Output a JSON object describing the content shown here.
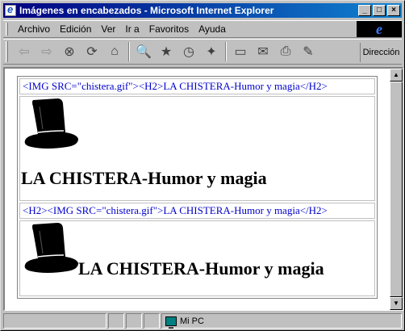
{
  "window": {
    "title": "Imágenes en encabezados - Microsoft Internet Explorer",
    "controls": {
      "minimize": "_",
      "maximize": "□",
      "close": "×"
    }
  },
  "menubar": {
    "items": [
      "Archivo",
      "Edición",
      "Ver",
      "Ir a",
      "Favoritos",
      "Ayuda"
    ],
    "logo_icon": "ie-logo-icon",
    "logo_text": "e"
  },
  "toolbar": {
    "buttons": [
      {
        "name": "back-icon",
        "glyph": "⇦"
      },
      {
        "name": "forward-icon",
        "glyph": "⇨"
      },
      {
        "name": "stop-icon",
        "glyph": "⊗"
      },
      {
        "name": "refresh-icon",
        "glyph": "⟳"
      },
      {
        "name": "home-icon",
        "glyph": "⌂"
      },
      {
        "name": "search-icon",
        "glyph": "🔍"
      },
      {
        "name": "favorites-icon",
        "glyph": "★"
      },
      {
        "name": "history-icon",
        "glyph": "◷"
      },
      {
        "name": "channels-icon",
        "glyph": "✦"
      },
      {
        "name": "fullscreen-icon",
        "glyph": "▭"
      },
      {
        "name": "mail-icon",
        "glyph": "✉"
      },
      {
        "name": "print-icon",
        "glyph": "⎙"
      },
      {
        "name": "edit-icon",
        "glyph": "✎"
      }
    ],
    "address_label": "Dirección"
  },
  "content": {
    "row1_code": "<IMG SRC=\"chistera.gif\"><H2>LA CHISTERA-Humor y magia</H2>",
    "row1_heading": "LA CHISTERA-Humor y magia",
    "row2_code": "<H2><IMG SRC=\"chistera.gif\">LA CHISTERA-Humor y magia</H2>",
    "row2_heading": "LA CHISTERA-Humor y magia",
    "image_name": "top-hat-image"
  },
  "statusbar": {
    "zone_text": "Mi PC",
    "zone_icon": "computer-icon"
  },
  "colors": {
    "titlebar_start": "#000080",
    "titlebar_end": "#1084d0",
    "code_text": "#0000cc",
    "chrome": "#c0c0c0"
  }
}
